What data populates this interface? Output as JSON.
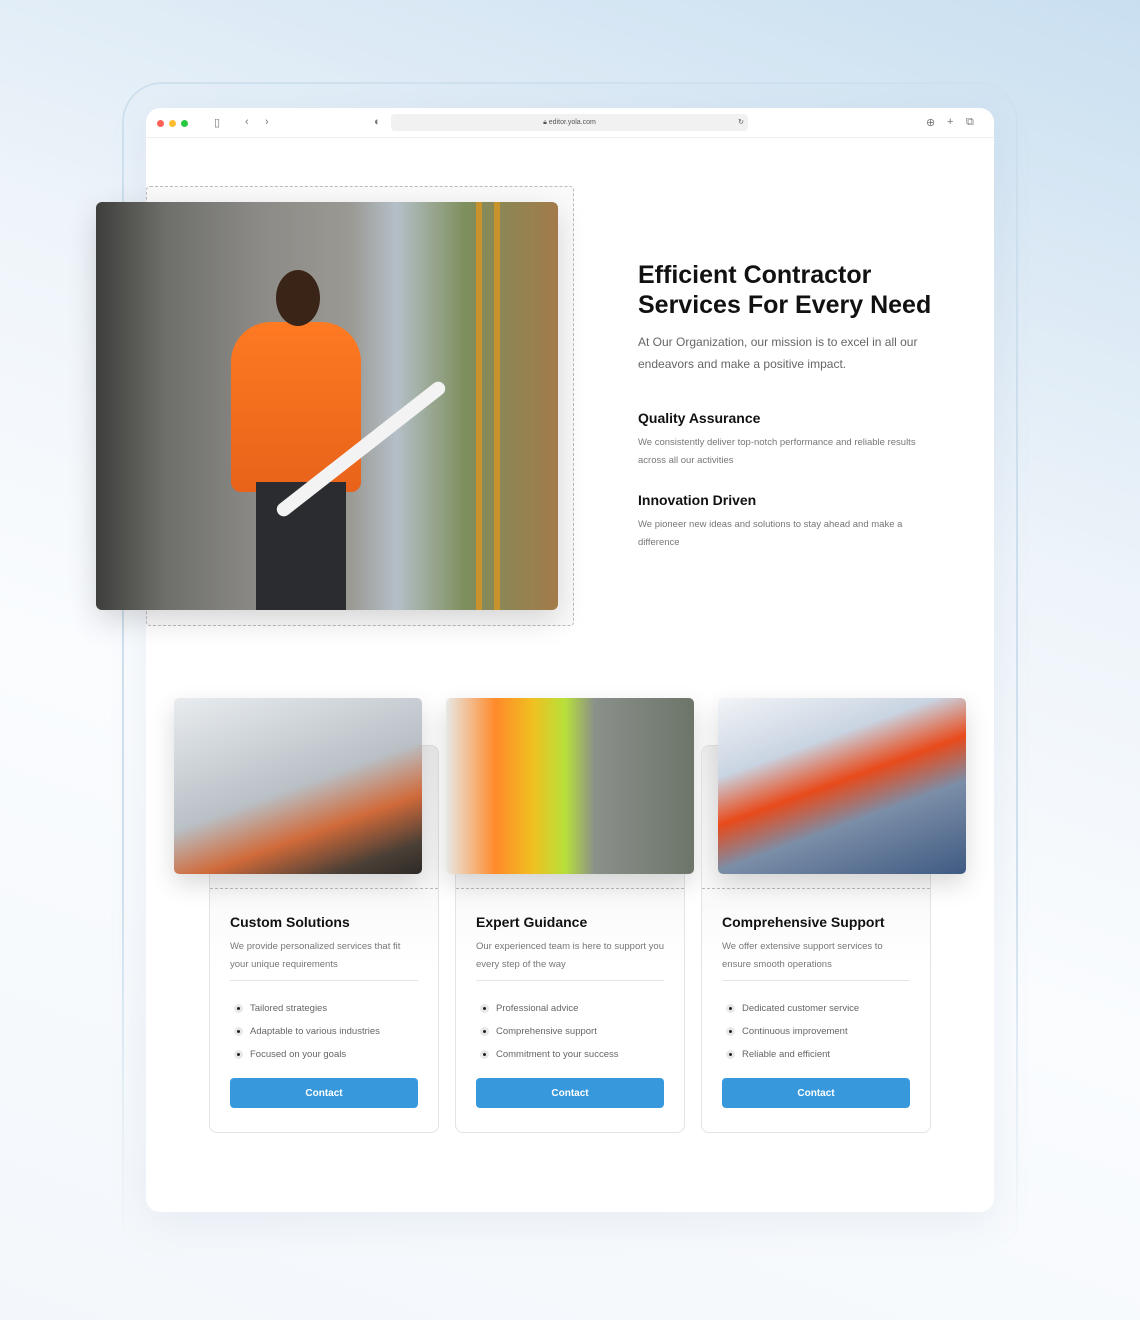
{
  "browser": {
    "url": "editor.yola.com",
    "traffic_colors": [
      "#fe5f57",
      "#febc2e",
      "#28c840"
    ]
  },
  "hero": {
    "title": "Efficient Contractor Services For Every Need",
    "lead": "At Our Organization, our mission is to excel in all our endeavors and make a positive impact.",
    "features": [
      {
        "title": "Quality Assurance",
        "text": "We consistently deliver top-notch performance and reliable results across all our activities"
      },
      {
        "title": "Innovation Driven",
        "text": "We pioneer new ideas and solutions to stay ahead and make a difference"
      }
    ]
  },
  "cards": [
    {
      "title": "Custom Solutions",
      "desc": "We provide personalized services that fit your unique requirements",
      "items": [
        "Tailored strategies",
        "Adaptable to various industries",
        "Focused on your goals"
      ],
      "button": "Contact"
    },
    {
      "title": "Expert Guidance",
      "desc": "Our experienced team is here to support you every step of the way",
      "items": [
        "Professional advice",
        "Comprehensive support",
        "Commitment to your success"
      ],
      "button": "Contact"
    },
    {
      "title": "Comprehensive Support",
      "desc": "We offer extensive support services to ensure smooth operations",
      "items": [
        "Dedicated customer service",
        "Continuous improvement",
        "Reliable and efficient"
      ],
      "button": "Contact"
    }
  ],
  "accent": "#3799dc"
}
